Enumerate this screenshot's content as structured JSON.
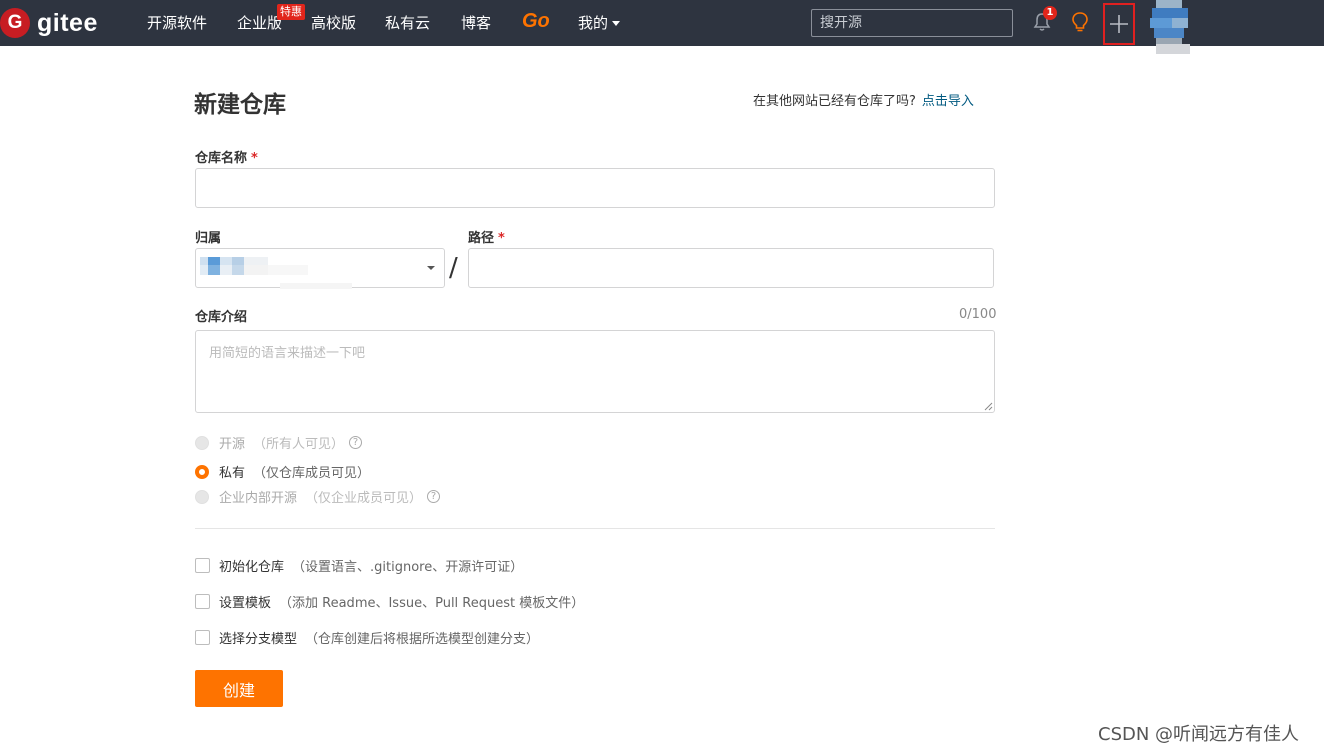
{
  "nav": {
    "logo_letter": "G",
    "logo_text": "gitee",
    "items": [
      {
        "label": "开源软件"
      },
      {
        "label": "企业版"
      },
      {
        "label": "高校版"
      },
      {
        "label": "私有云"
      },
      {
        "label": "博客"
      },
      {
        "label": "Go"
      },
      {
        "label": "我的"
      }
    ],
    "enterprise_badge": "特惠",
    "search_placeholder": "搜开源",
    "notification_count": "1",
    "icons": [
      "bell-icon",
      "lightbulb-icon",
      "plus-icon"
    ],
    "colors": {
      "bar": "#2e3440",
      "brand": "#c71d23",
      "go": "#fe7300"
    }
  },
  "form": {
    "title": "新建仓库",
    "import_prompt": "在其他网站已经有仓库了吗?",
    "import_link": "点击导入",
    "repo_name_label": "仓库名称",
    "required_mark": "*",
    "owner_label": "归属",
    "path_label": "路径",
    "slash": "/",
    "description_label": "仓库介绍",
    "description_counter": "0/100",
    "description_placeholder": "用简短的语言来描述一下吧",
    "visibility": [
      {
        "label": "开源",
        "note": "（所有人可见）",
        "state": "disabled",
        "help": "?"
      },
      {
        "label": "私有",
        "note": "（仅仓库成员可见）",
        "state": "checked"
      },
      {
        "label": "企业内部开源",
        "note": "（仅企业成员可见）",
        "state": "disabled",
        "help": "?"
      }
    ],
    "options": [
      {
        "label": "初始化仓库",
        "note": "（设置语言、.gitignore、开源许可证）",
        "checked": false
      },
      {
        "label": "设置模板",
        "note": "（添加 Readme、Issue、Pull Request 模板文件）",
        "checked": false
      },
      {
        "label": "选择分支模型",
        "note": "（仓库创建后将根据所选模型创建分支）",
        "checked": false
      }
    ],
    "submit_label": "创建",
    "accent_color": "#fe7300"
  },
  "watermark": "CSDN @听闻远方有佳人"
}
